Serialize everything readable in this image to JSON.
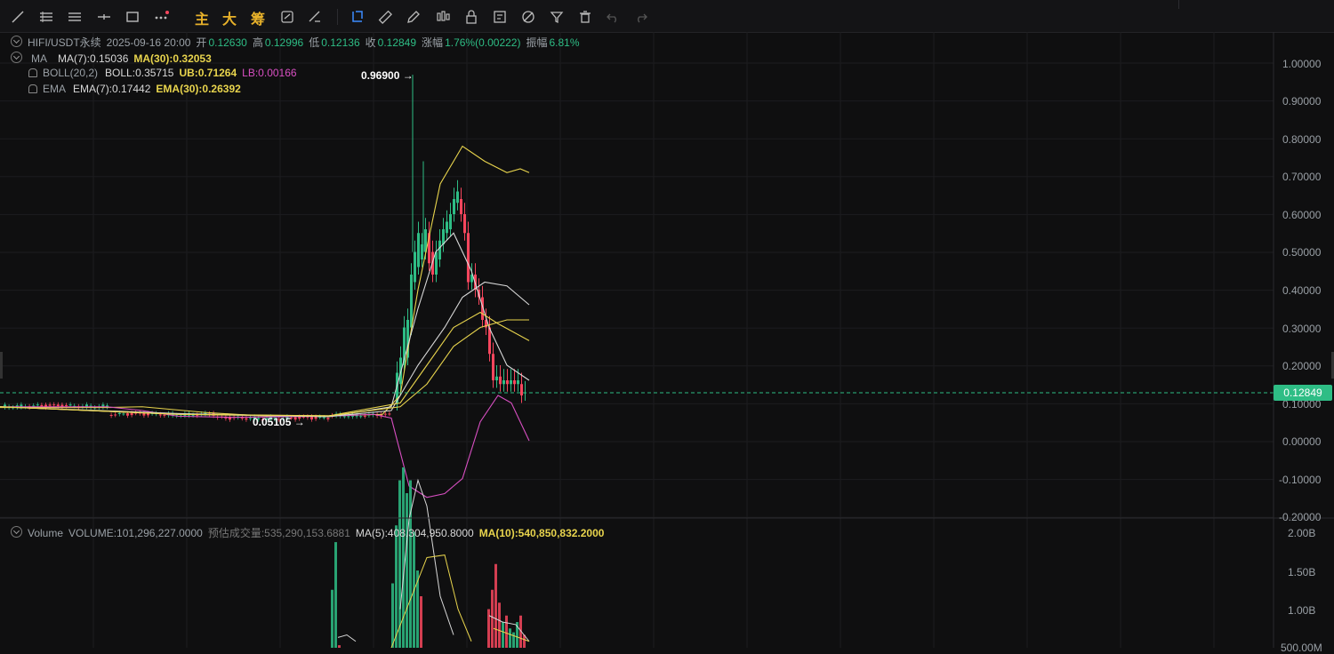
{
  "toolbar": {
    "text_buttons": [
      "主",
      "大",
      "筹"
    ]
  },
  "header": {
    "symbol": "HIFI/USDT永续",
    "datetime": "2025-09-16 20:00",
    "open_label": "开",
    "open": "0.12630",
    "high_label": "高",
    "high": "0.12996",
    "low_label": "低",
    "low": "0.12136",
    "close_label": "收",
    "close": "0.12849",
    "change_label": "涨幅",
    "change": "1.76%(0.00222)",
    "amp_label": "振幅",
    "amp": "6.81%"
  },
  "indicators": {
    "ma_name": "MA",
    "ma7": "MA(7):0.15036",
    "ma30": "MA(30):0.32053",
    "boll_name": "BOLL(20,2)",
    "boll": "BOLL:0.35715",
    "ub": "UB:0.71264",
    "lb": "LB:0.00166",
    "ema_name": "EMA",
    "ema7": "EMA(7):0.17442",
    "ema30": "EMA(30):0.26392"
  },
  "annotations": {
    "high": "0.96900 →",
    "low": "0.05105 →"
  },
  "price_axis": [
    "1.00000",
    "0.90000",
    "0.80000",
    "0.70000",
    "0.60000",
    "0.50000",
    "0.40000",
    "0.30000",
    "0.20000",
    "0.10000",
    "0.00000",
    "-0.10000",
    "-0.20000"
  ],
  "current_price": "0.12849",
  "volume": {
    "name": "Volume",
    "volume": "VOLUME:101,296,227.0000",
    "estimated": "预估成交量:535,290,153.6881",
    "ma5": "MA(5):408,304,950.8000",
    "ma10": "MA(10):540,850,832.2000"
  },
  "volume_axis": [
    "2.00B",
    "1.50B",
    "1.00B",
    "500.00M"
  ],
  "colors": {
    "up": "#2ebd85",
    "down": "#f6465d",
    "yellow": "#e8d44d",
    "white": "#d8d8d8",
    "magenta": "#d84fc2",
    "accent": "#e7b12a",
    "tool_blue": "#3d8bff"
  }
}
